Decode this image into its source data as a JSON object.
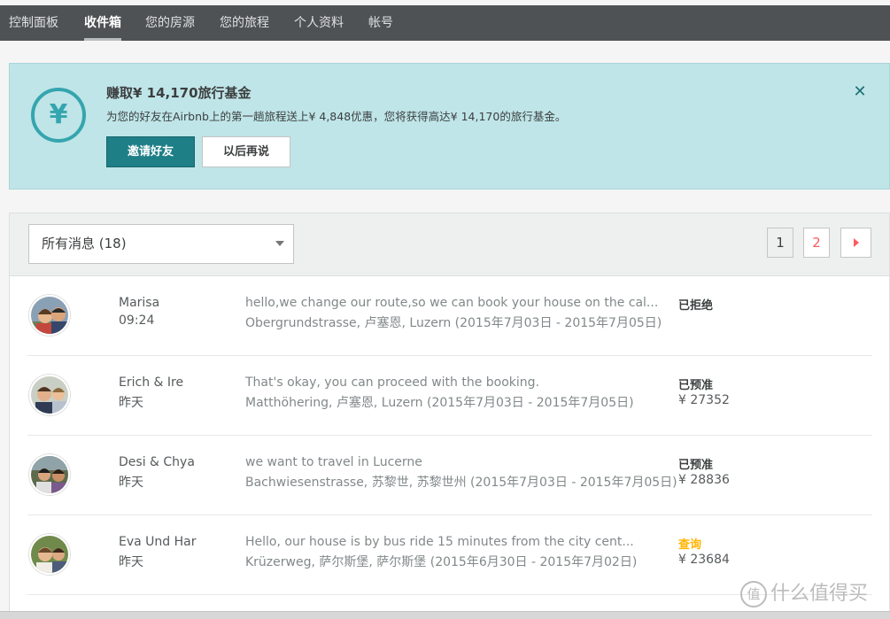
{
  "nav": {
    "items": [
      {
        "label": "控制面板"
      },
      {
        "label": "收件箱"
      },
      {
        "label": "您的房源"
      },
      {
        "label": "您的旅程"
      },
      {
        "label": "个人资料"
      },
      {
        "label": "帐号"
      }
    ],
    "active": "收件箱"
  },
  "banner": {
    "icon": "yen-circle-icon",
    "icon_glyph": "¥",
    "title": "赚取¥ 14,170旅行基金",
    "description": "为您的好友在Airbnb上的第一趟旅程送上¥ 4,848优惠，您将获得高达¥ 14,170的旅行基金。",
    "invite_label": "邀请好友",
    "later_label": "以后再说",
    "close_glyph": "✕",
    "accent_color": "#1f7f87",
    "background_color": "#bfe5e8"
  },
  "inbox": {
    "filter": {
      "selected": "所有消息 (18)"
    },
    "pagination": {
      "pages": [
        "1",
        "2"
      ],
      "current": "1"
    },
    "threads": [
      {
        "name": "Marisa",
        "time": "09:24",
        "message": "hello,we change our route,so we can book your house on the cal...",
        "location": "Obergrundstrasse, 卢塞恩, Luzern (2015年7月03日 - 2015年7月05日)",
        "status": "已拒绝",
        "price": ""
      },
      {
        "name": "Erich & Ire",
        "time": "昨天",
        "message": "That's okay, you can proceed with the booking.",
        "location": "Matthöhering, 卢塞恩, Luzern (2015年7月03日 - 2015年7月05日)",
        "status": "已预准",
        "price": "¥ 27352"
      },
      {
        "name": "Desi & Chya",
        "time": "昨天",
        "message": "we want to travel in Lucerne",
        "location": "Bachwiesenstrasse, 苏黎世, 苏黎世州 (2015年7月03日 - 2015年7月05日)",
        "status": "已预准",
        "price": "¥ 28836"
      },
      {
        "name": "Eva Und Har",
        "time": "昨天",
        "message": "Hello, our house is by bus ride 15 minutes from the city cent...",
        "location": "Krüzerweg, 萨尔斯堡, 萨尔斯堡 (2015年6月30日 - 2015年7月02日)",
        "status": "查询",
        "price": "¥ 23684"
      }
    ],
    "status_colors": {
      "default": "#3c3f40",
      "inquiry": "#ffb400"
    }
  },
  "watermark": {
    "glyph": "值",
    "text": "什么值得买"
  }
}
